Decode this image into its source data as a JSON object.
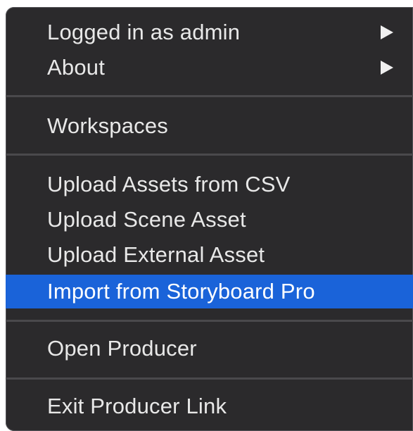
{
  "menu": {
    "items": [
      {
        "label": "Logged in as admin",
        "submenu": true
      },
      {
        "label": "About",
        "submenu": true
      },
      {
        "label": "Workspaces",
        "submenu": false
      },
      {
        "label": "Upload Assets from CSV",
        "submenu": false
      },
      {
        "label": "Upload Scene Asset",
        "submenu": false
      },
      {
        "label": "Upload External Asset",
        "submenu": false
      },
      {
        "label": "Import from Storyboard Pro",
        "submenu": false,
        "highlighted": true
      },
      {
        "label": "Open Producer",
        "submenu": false
      },
      {
        "label": "Exit Producer Link",
        "submenu": false
      }
    ]
  },
  "colors": {
    "menu_background": "#2b2a2c",
    "highlight": "#1a63d9",
    "separator": "#4a494c",
    "text": "#e8e8e8"
  }
}
